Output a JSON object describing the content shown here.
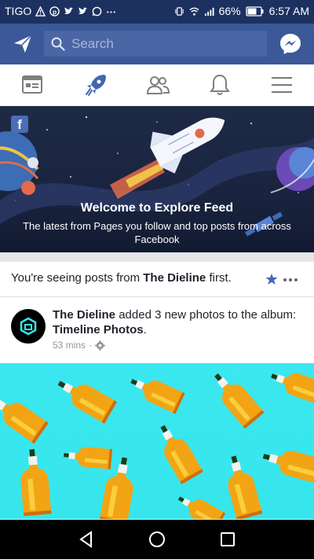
{
  "status_bar": {
    "carrier": "TIGO",
    "battery": "66%",
    "time": "6:57 AM"
  },
  "app_bar": {
    "search_placeholder": "Search"
  },
  "hero": {
    "title": "Welcome to Explore Feed",
    "subtitle": "The latest from Pages you follow and top posts from across Facebook"
  },
  "seeing": {
    "prefix": "You're seeing posts from ",
    "page": "The Dieline",
    "suffix": " first."
  },
  "post": {
    "author": "The Dieline",
    "action": " added 3 new photos to the album: ",
    "album": "Timeline Photos",
    "album_suffix": ".",
    "time": "53 mins",
    "separator": "·"
  },
  "colors": {
    "brand": "#3b5998",
    "status": "#1d3160",
    "accent": "#4267b2",
    "photo_bg": "#36e6ec"
  }
}
